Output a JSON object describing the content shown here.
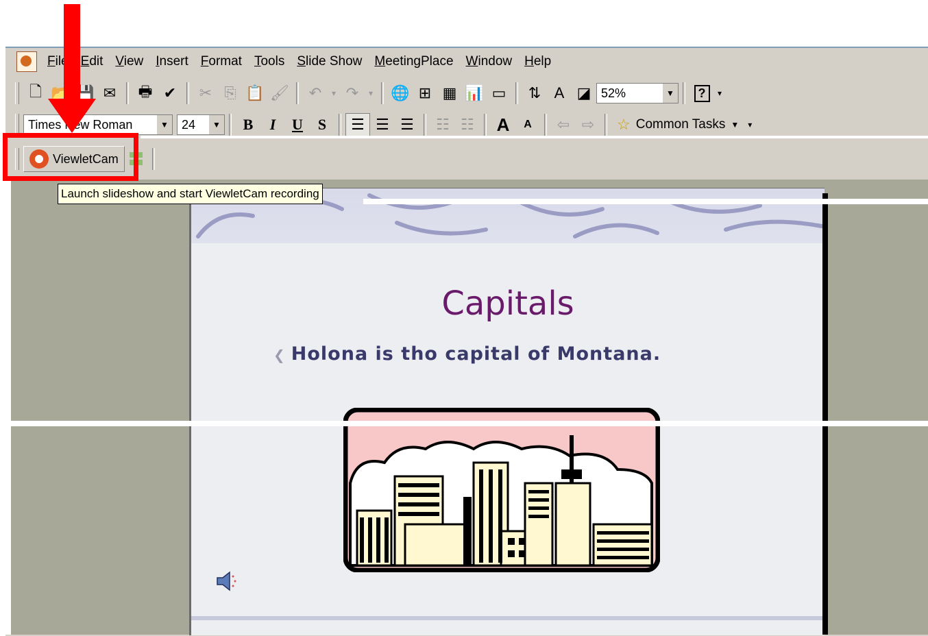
{
  "menu": {
    "items": [
      "File",
      "Edit",
      "View",
      "Insert",
      "Format",
      "Tools",
      "Slide Show",
      "MeetingPlace",
      "Window",
      "Help"
    ]
  },
  "toolbar": {
    "zoom": "52%",
    "font_name": "Times New Roman",
    "font_size": "24",
    "bold": "B",
    "italic": "I",
    "underline": "U",
    "shadow": "S",
    "common_tasks": "Common Tasks",
    "help_glyph": "?"
  },
  "viewletcam": {
    "label": "ViewletCam",
    "tooltip": "Launch slideshow and start ViewletCam recording"
  },
  "slide": {
    "title": "Capitals",
    "bullet": "Holona is tho capital of Montana."
  },
  "colors": {
    "highlight": "#ff0000",
    "title": "#6a1a6a",
    "workspace": "#a8a898"
  }
}
